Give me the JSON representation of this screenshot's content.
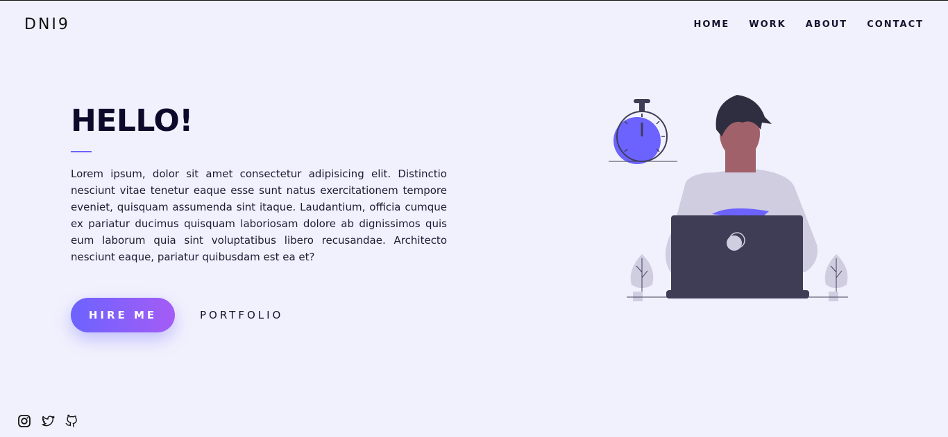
{
  "brand": {
    "logo": "DNI9"
  },
  "nav": {
    "items": [
      {
        "label": "HOME"
      },
      {
        "label": "WORK"
      },
      {
        "label": "ABOUT"
      },
      {
        "label": "CONTACT"
      }
    ]
  },
  "hero": {
    "title": "HELLO!",
    "description": "Lorem ipsum, dolor sit amet consectetur adipisicing elit. Distinctio nesciunt vitae tenetur eaque esse sunt natus exercitationem tempore eveniet, quisquam assumenda sint itaque. Laudantium, officia cumque ex pariatur ducimus quisquam laboriosam dolore ab dignissimos quis eum laborum quia sint voluptatibus libero recusandae. Architecto nesciunt eaque, pariatur quibusdam est ea et?",
    "primary_button": "HIRE ME",
    "secondary_button": "PORTFOLIO"
  },
  "colors": {
    "background": "#f1f1fd",
    "accent": "#6c63ff",
    "accent_end": "#a55cf5",
    "heading": "#0c0a2a"
  },
  "illustration": {
    "icons": [
      "stopwatch-icon",
      "person-icon",
      "laptop-icon",
      "plant-icon"
    ]
  },
  "socials": {
    "icons": [
      "instagram-icon",
      "twitter-icon",
      "github-icon"
    ]
  }
}
